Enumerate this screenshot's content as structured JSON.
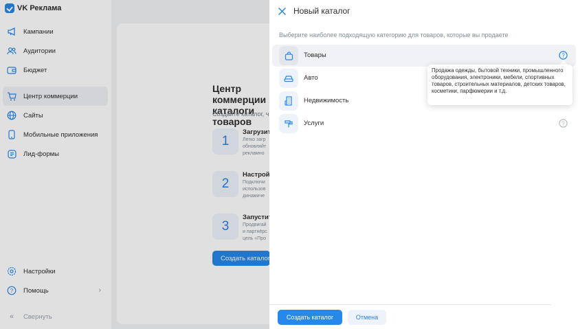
{
  "app": {
    "name": "VK Реклама"
  },
  "sidebar": {
    "items": [
      {
        "label": "Кампании",
        "icon": "megaphone-icon"
      },
      {
        "label": "Аудитории",
        "icon": "users-icon"
      },
      {
        "label": "Бюджет",
        "icon": "wallet-icon"
      },
      {
        "label": "Центр коммерции",
        "icon": "cart-icon",
        "active": true
      },
      {
        "label": "Сайты",
        "icon": "globe-icon"
      },
      {
        "label": "Мобильные приложения",
        "icon": "smartphone-icon"
      },
      {
        "label": "Лид-формы",
        "icon": "form-icon"
      }
    ],
    "bottom": [
      {
        "label": "Настройки",
        "icon": "gear-icon"
      },
      {
        "label": "Помощь",
        "icon": "help-icon"
      },
      {
        "label": "Свернуть",
        "icon": "collapse-icon"
      }
    ]
  },
  "background": {
    "title": "Центр коммерции и каталоги товаров",
    "subtitle": "Создайте каталог, ч",
    "steps": [
      {
        "num": "1",
        "title": "Загрузите",
        "text": "Легко загр обновляйт рекламно"
      },
      {
        "num": "2",
        "title": "Настройте",
        "text": "Подключи использов динамиче"
      },
      {
        "num": "3",
        "title": "Запустите",
        "text": "Продвигай и партнёрс цель «Про"
      }
    ],
    "button": "Создать каталог"
  },
  "modal": {
    "title": "Новый каталог",
    "hint": "Выберите наиболее подходящую категорию для товаров, которые вы продаете",
    "categories": [
      {
        "label": "Товары",
        "icon": "shopping-bag-icon",
        "selected": true
      },
      {
        "label": "Авто",
        "icon": "car-icon"
      },
      {
        "label": "Недвижимость",
        "icon": "building-icon"
      },
      {
        "label": "Услуги",
        "icon": "services-icon"
      }
    ],
    "tooltip": "Продажа одежды, бытовой техники, промышленного оборудования, электроники, мебели, спортивных товаров, строительных материалов, детских товаров, косметики, парфюмерии и т.д.",
    "create_button": "Создать каталог",
    "cancel_button": "Отмена"
  },
  "colors": {
    "accent": "#2688eb",
    "accent_soft": "#eef3fb",
    "text": "#2c2d2e",
    "muted": "#818c99"
  }
}
